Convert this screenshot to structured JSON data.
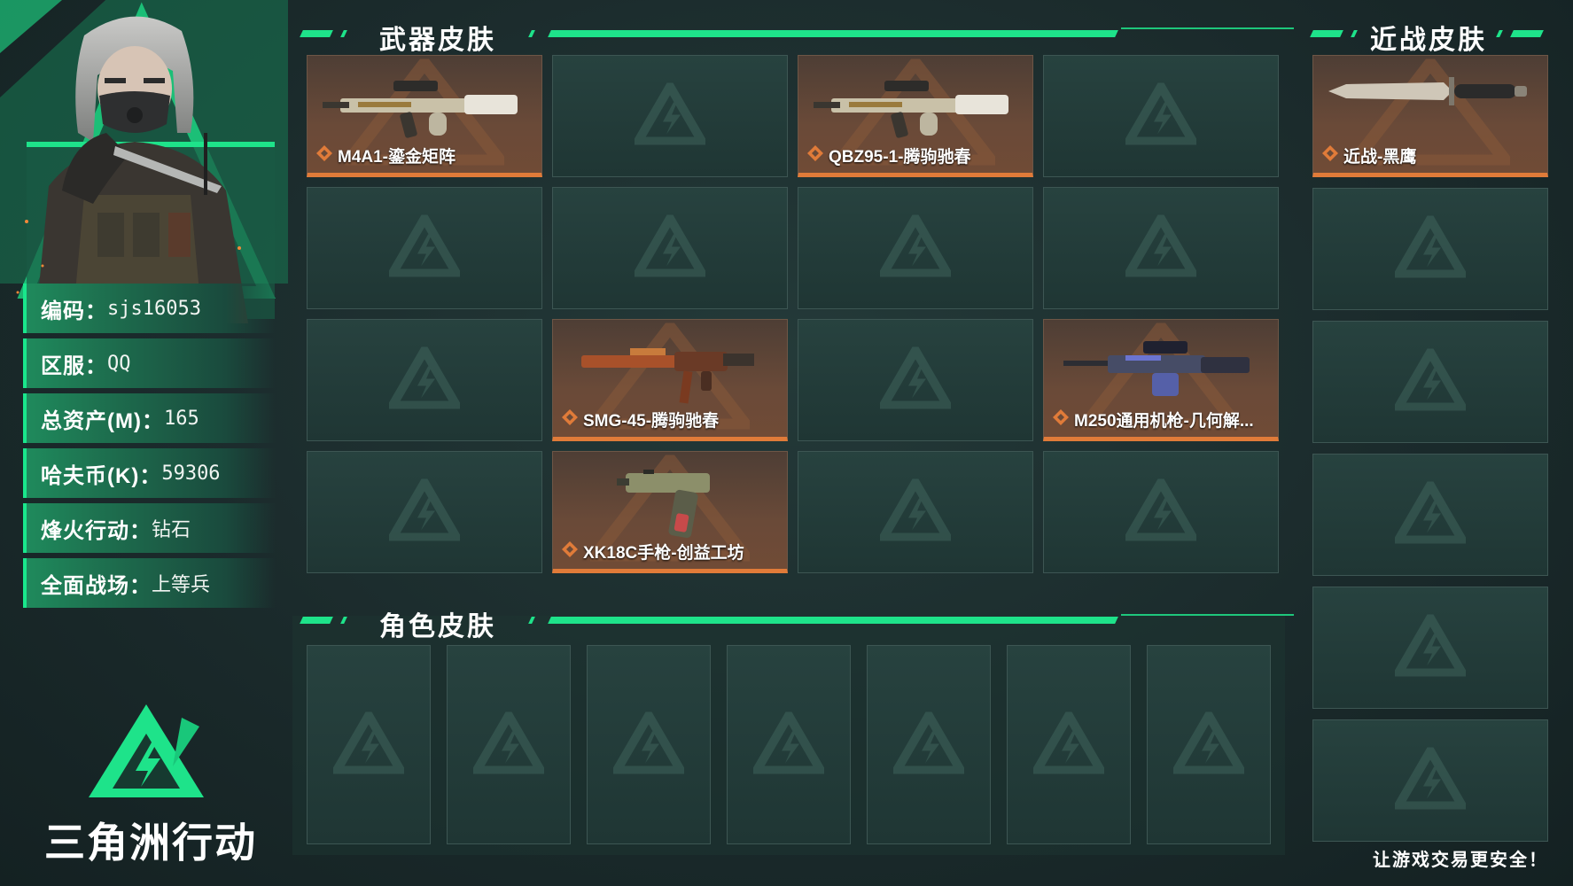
{
  "profile": {
    "rows": [
      {
        "label": "编码：",
        "value": "sjs16053"
      },
      {
        "label": "区服：",
        "value": "QQ"
      },
      {
        "label": "总资产(M)：",
        "value": "165"
      },
      {
        "label": "哈夫币(K)：",
        "value": "59306"
      },
      {
        "label": "烽火行动：",
        "value": "钻石"
      },
      {
        "label": "全面战场：",
        "value": "上等兵"
      }
    ],
    "brand_name": "三角洲行动",
    "portrait_icon": "operator-portrait"
  },
  "weapon_section": {
    "title": "武器皮肤",
    "cards": [
      {
        "name": "M4A1-鎏金矩阵",
        "icon": "rifle-icon"
      },
      {
        "name": "",
        "icon": ""
      },
      {
        "name": "QBZ95-1-腾驹驰春",
        "icon": "rifle-icon"
      },
      {
        "name": "",
        "icon": ""
      },
      {
        "name": "",
        "icon": ""
      },
      {
        "name": "",
        "icon": ""
      },
      {
        "name": "",
        "icon": ""
      },
      {
        "name": "",
        "icon": ""
      },
      {
        "name": "",
        "icon": ""
      },
      {
        "name": "SMG-45-腾驹驰春",
        "icon": "smg-icon"
      },
      {
        "name": "",
        "icon": ""
      },
      {
        "name": "M250通用机枪-几何解...",
        "icon": "machine-gun-icon"
      },
      {
        "name": "",
        "icon": ""
      },
      {
        "name": "XK18C手枪-创益工坊",
        "icon": "pistol-icon"
      },
      {
        "name": "",
        "icon": ""
      },
      {
        "name": "",
        "icon": ""
      }
    ]
  },
  "character_section": {
    "title": "角色皮肤",
    "cards": [
      {},
      {},
      {},
      {},
      {},
      {},
      {}
    ]
  },
  "melee_section": {
    "title": "近战皮肤",
    "cards": [
      {
        "name": "近战-黑鹰",
        "icon": "knife-icon"
      },
      {
        "name": ""
      },
      {
        "name": ""
      },
      {
        "name": ""
      },
      {
        "name": ""
      },
      {
        "name": ""
      }
    ]
  },
  "footer": {
    "slogan": "让游戏交易更安全！"
  },
  "colors": {
    "accent": "#1ee38a",
    "card_orange": "#e07b39",
    "bg": "#1b2b2c"
  }
}
